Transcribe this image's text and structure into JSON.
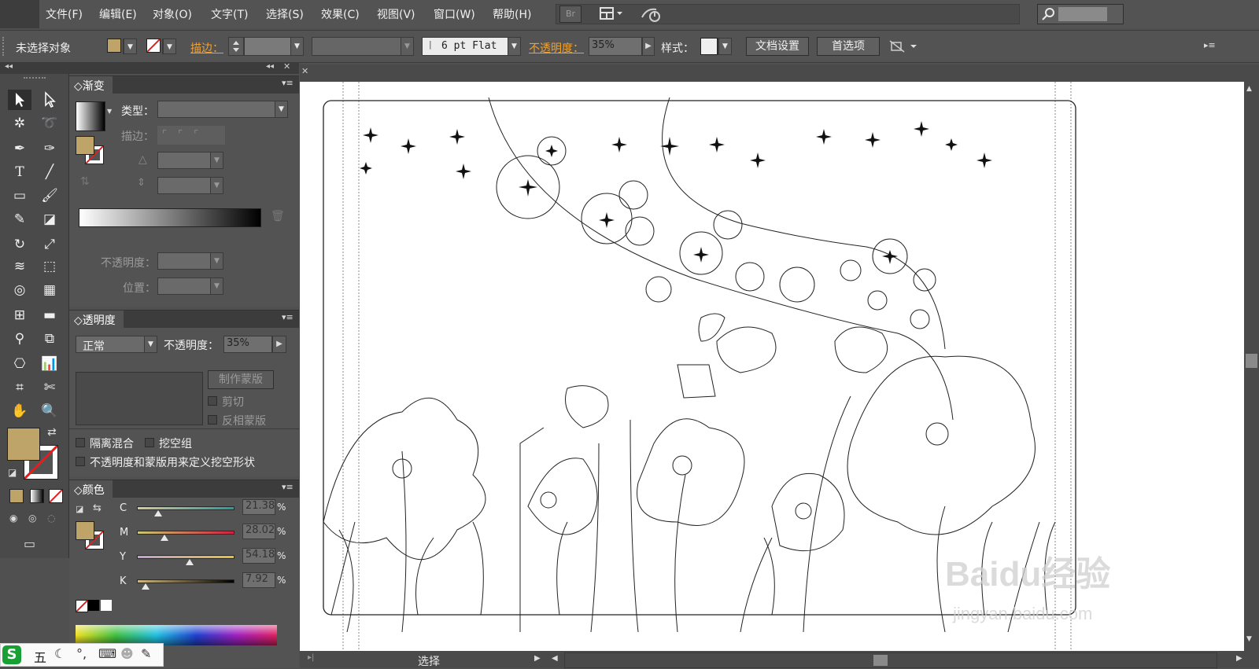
{
  "menu": [
    "文件(F)",
    "编辑(E)",
    "对象(O)",
    "文字(T)",
    "选择(S)",
    "效果(C)",
    "视图(V)",
    "窗口(W)",
    "帮助(H)"
  ],
  "menu_icons": {
    "bridge": "Br",
    "workspace_icon": "layout-grid-icon",
    "sync_icon": "sync-settings-icon",
    "search_icon": "search-icon"
  },
  "control_bar": {
    "selection_status": "未选择对象",
    "stroke_label": "描边：",
    "brush_value": "6 pt Flat",
    "opacity_label": "不透明度：",
    "opacity_value": "35%",
    "style_label": "样式：",
    "document_setup_button": "文档设置",
    "preferences_button": "首选项"
  },
  "colors": {
    "fill": "#bfa46a",
    "accent_orange": "#f0a030",
    "ui_dark": "#535353"
  },
  "gradient_panel": {
    "title": "渐变",
    "type_label": "类型：",
    "stroke_label": "描边：",
    "opacity_label": "不透明度：",
    "position_label": "位置："
  },
  "transparency_panel": {
    "title": "透明度",
    "blend_mode": "正常",
    "opacity_label": "不透明度：",
    "opacity_value": "35%",
    "make_mask_button": "制作蒙版",
    "clip_label": "剪切",
    "invert_mask_label": "反相蒙版",
    "isolate_blending_label": "隔离混合",
    "knockout_group_label": "挖空组",
    "opacity_mask_label": "不透明度和蒙版用来定义挖空形状"
  },
  "color_panel": {
    "title": "颜色",
    "channels": [
      {
        "name": "C",
        "value": "21.38",
        "fraction": 0.21
      },
      {
        "name": "M",
        "value": "28.02",
        "fraction": 0.28
      },
      {
        "name": "Y",
        "value": "54.18",
        "fraction": 0.54
      },
      {
        "name": "K",
        "value": "7.92",
        "fraction": 0.08
      }
    ],
    "percent": "%"
  },
  "status_bar": {
    "tool_name": "选择"
  },
  "ime_bar": {
    "logo": "S",
    "mode": "五"
  },
  "watermark": {
    "brand": "Baidu经验",
    "url": "jingyan.baidu.com"
  }
}
